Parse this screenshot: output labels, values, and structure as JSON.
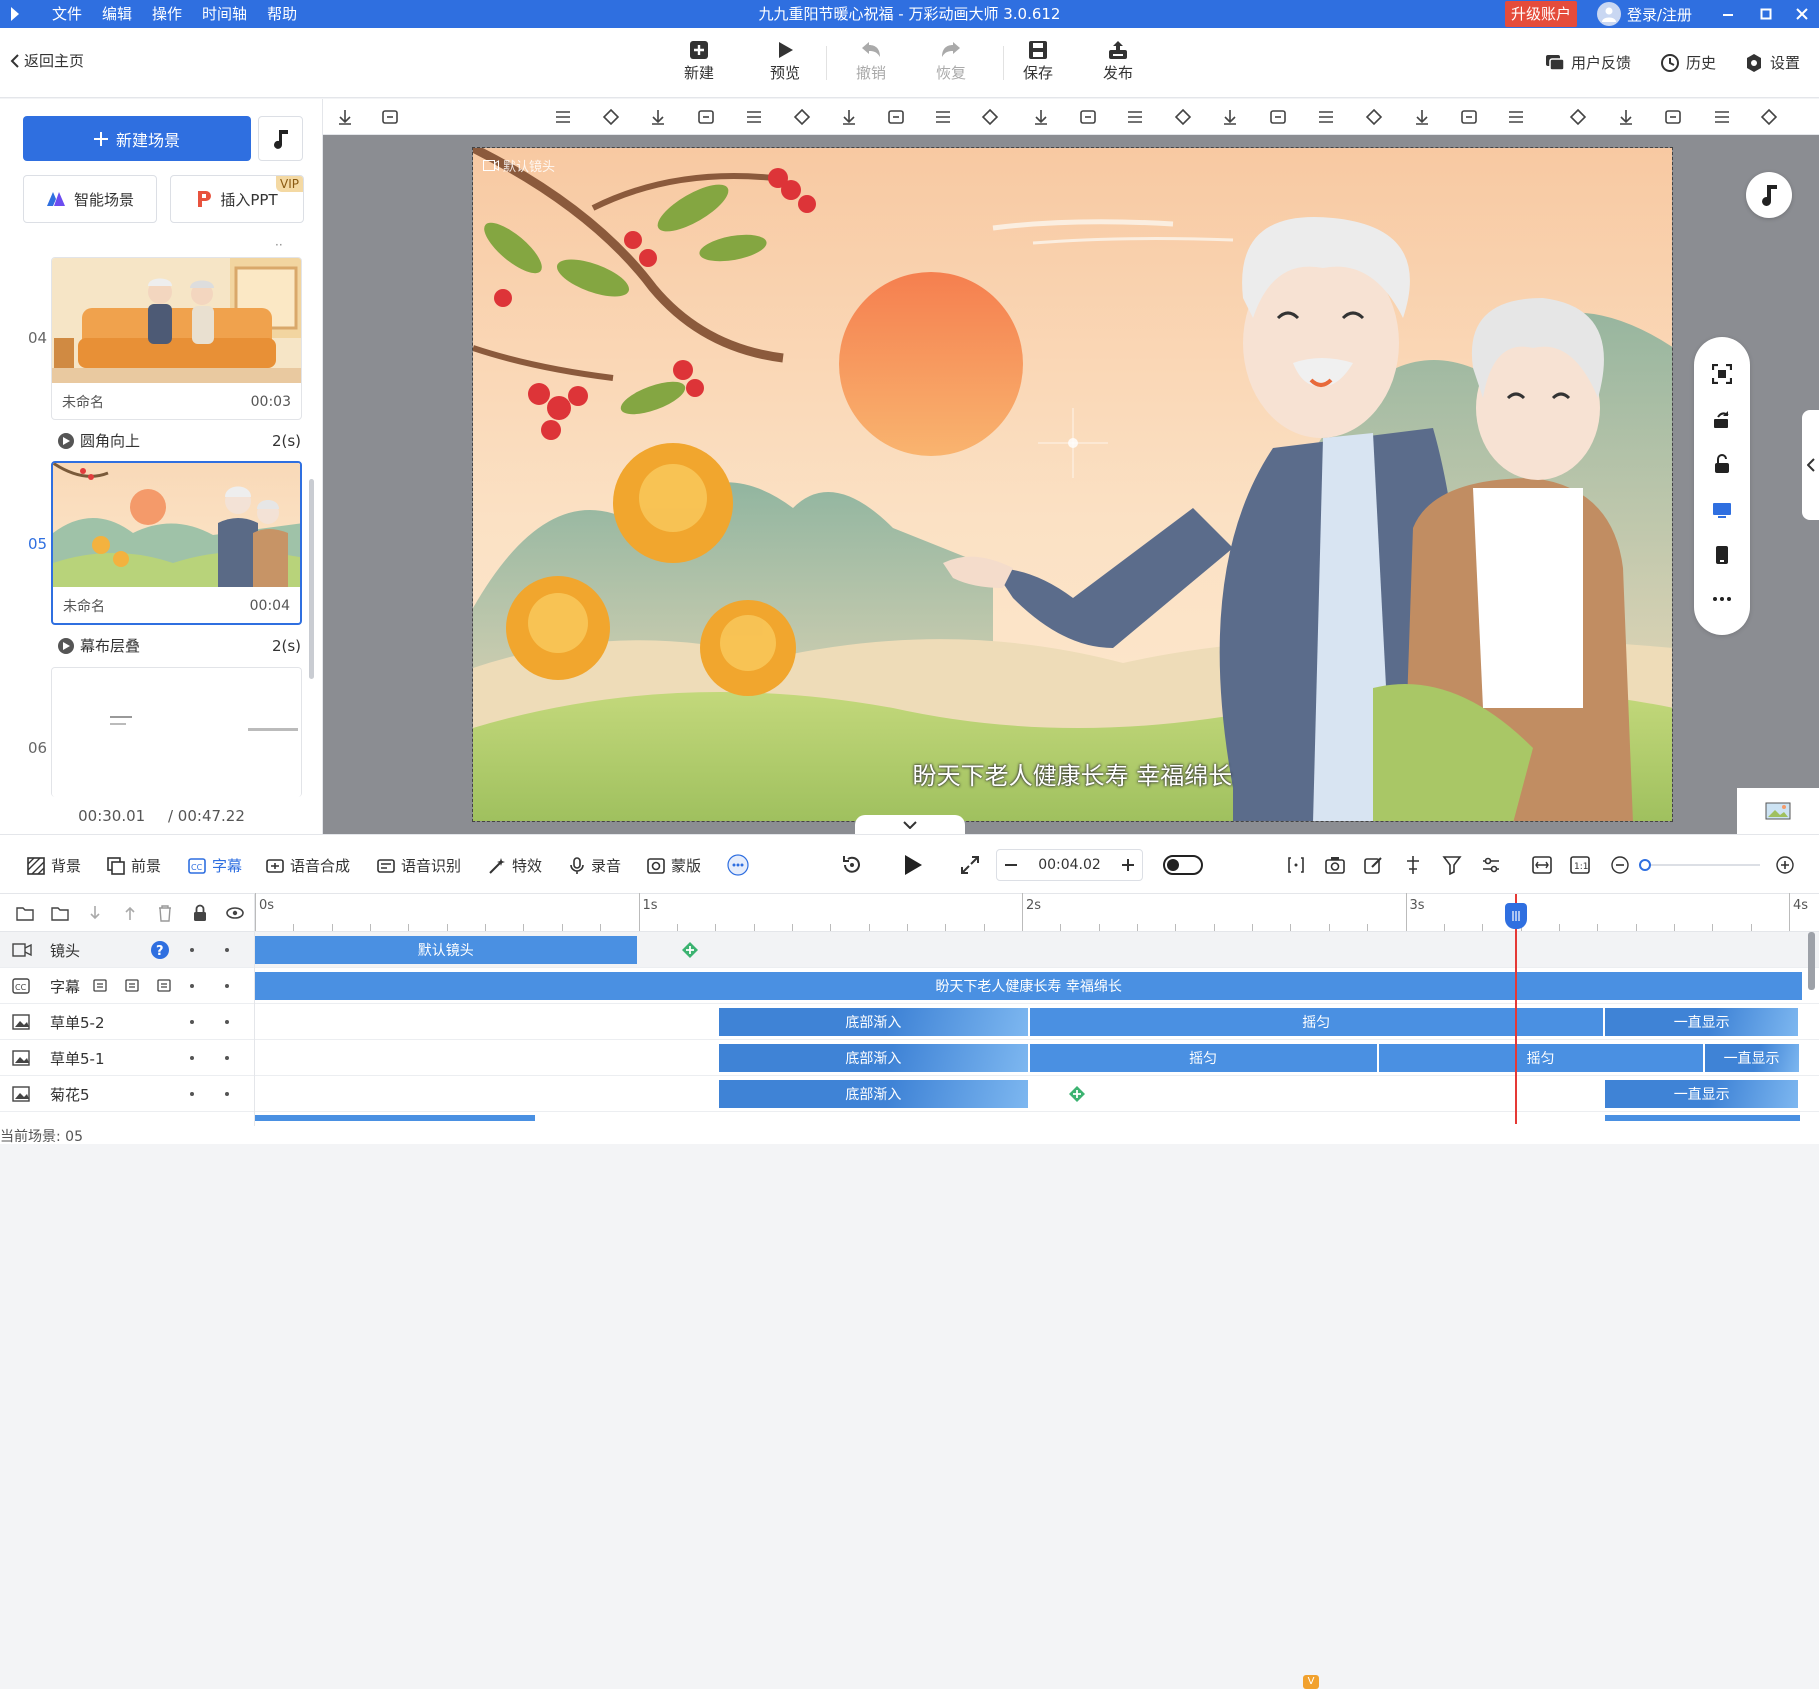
{
  "titlebar": {
    "menu": [
      "文件",
      "编辑",
      "操作",
      "时间轴",
      "帮助"
    ],
    "title": "九九重阳节暖心祝福 - 万彩动画大师 3.0.612",
    "upgrade": "升级账户",
    "login": "登录/注册"
  },
  "toolbar": {
    "back": "返回主页",
    "new": "新建",
    "preview": "预览",
    "undo": "撤销",
    "redo": "恢复",
    "save": "保存",
    "publish": "发布",
    "feedback": "用户反馈",
    "history": "历史",
    "settings": "设置"
  },
  "left": {
    "new_scene": "新建场景",
    "smart_scene": "智能场景",
    "insert_ppt": "插入PPT",
    "vip": "VIP",
    "scenes": [
      {
        "num": "04",
        "name": "未命名",
        "duration": "00:03"
      },
      {
        "num": "05",
        "name": "未命名",
        "duration": "00:04"
      },
      {
        "num": "06",
        "name": "",
        "duration": ""
      }
    ],
    "transitions": [
      {
        "name": "圆角向上",
        "duration": "2(s)"
      },
      {
        "name": "幕布层叠",
        "duration": "2(s)"
      }
    ],
    "time_current": "00:30.01",
    "time_total": "/ 00:47.22"
  },
  "stage": {
    "camera_label": "默认镜头",
    "subtitle": "盼天下老人健康长寿 幸福绵长"
  },
  "bottom_tabs": [
    "背景",
    "前景",
    "字幕",
    "语音合成",
    "语音识别",
    "特效",
    "录音",
    "蒙版"
  ],
  "playback": {
    "time": "00:04.02"
  },
  "timeline": {
    "ruler": [
      "0s",
      "1s",
      "2s",
      "3s",
      "4s"
    ],
    "tracks": [
      {
        "name": "镜头",
        "clips": [
          "默认镜头"
        ]
      },
      {
        "name": "字幕",
        "clips": [
          "盼天下老人健康长寿 幸福绵长"
        ]
      },
      {
        "name": "草单5-2",
        "clips": [
          "底部渐入",
          "摇匀",
          "一直显示"
        ]
      },
      {
        "name": "草单5-1",
        "clips": [
          "底部渐入",
          "摇匀",
          "摇匀",
          "一直显示"
        ]
      },
      {
        "name": "菊花5",
        "clips": [
          "底部渐入",
          "一直显示"
        ]
      }
    ],
    "current_scene": "当前场景: 05"
  },
  "colors": {
    "accent": "#2f6fe0",
    "upgrade": "#e54c3b",
    "clip": "#4a90e2",
    "playhead": "#e53935"
  }
}
